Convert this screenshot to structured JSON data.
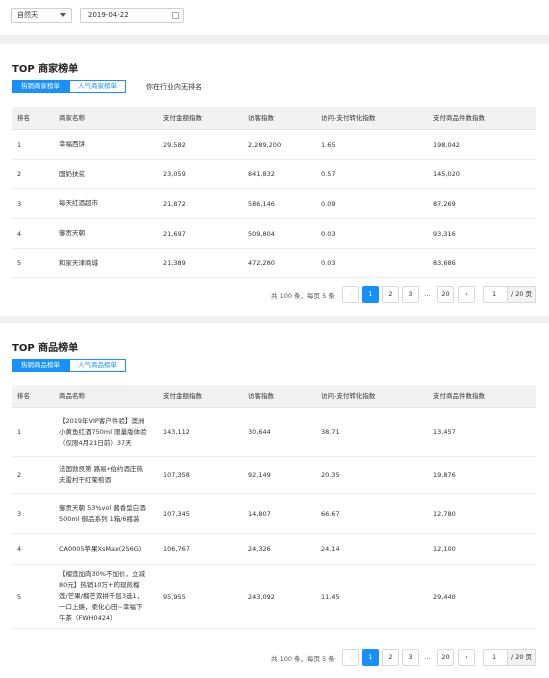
{
  "filters": {
    "period": "自然天",
    "date": "2019-04-22"
  },
  "merchant_section": {
    "title": "TOP 商家榜单",
    "tabs": [
      "热销商家榜单",
      "人气商家榜单"
    ],
    "note": "你在行业内无排名",
    "columns": [
      "排名",
      "商家名称",
      "支付金额指数",
      "访客指数",
      "访问-支付转化指数",
      "支付商品件数指数"
    ],
    "rows": [
      [
        "1",
        "幸福西饼",
        "29,582",
        "2,289,200",
        "1.65",
        "198,042"
      ],
      [
        "2",
        "国奶扶贫",
        "23,059",
        "841,832",
        "0.57",
        "145,020"
      ],
      [
        "3",
        "每天红酒超市",
        "21,872",
        "586,146",
        "0.09",
        "87,269"
      ],
      [
        "4",
        "御贡天朝",
        "21,697",
        "509,804",
        "0.03",
        "93,316"
      ],
      [
        "5",
        "和家天津商城",
        "21,389",
        "472,280",
        "0.03",
        "83,686"
      ]
    ],
    "pager": {
      "total": "共 100 条，每页 5 条",
      "prev": "‹",
      "pages": [
        "1",
        "2",
        "3"
      ],
      "ellipsis": "...",
      "last": "20",
      "next": "›",
      "jump": "1",
      "suffix": "/ 20 页"
    }
  },
  "product_section": {
    "title": "TOP 商品榜单",
    "tabs": [
      "热销商品榜单",
      "人气商品榜单"
    ],
    "columns": [
      "排名",
      "商品名称",
      "支付金额指数",
      "访客指数",
      "访问-支付转化指数",
      "支付商品件数指数"
    ],
    "rows": [
      [
        "1",
        "【2019年VIP客户件验】澳洲\n小黄鱼红酒750ml 限量版体验\n（仅限4月21日前）37天",
        "143,112",
        "30,644",
        "38.71",
        "13,457"
      ],
      [
        "2",
        "法国勃艮第 路易•伯约酒庄热\n夫雷村干红葡萄酒",
        "107,358",
        "92,149",
        "20.35",
        "19,876"
      ],
      [
        "3",
        "御贡天朝 53%vol 酱香型白酒\n500ml 御品系列 1箱/6瓶装",
        "107,345",
        "14,807",
        "66.67",
        "12,780"
      ],
      [
        "4",
        "CA0005苹果XsMax(256G)",
        "106,767",
        "24,326",
        "24.14",
        "12,100"
      ],
      [
        "5",
        "【榴莲加肉30%不加价，立减\n80元】热销10万+的现煎榴\n莲/芒果/榴芒双拼千层3选1，\n一口上瘾，柔化心田~幸福下\n午茶（FWH0424）",
        "95,955",
        "243,092",
        "11.45",
        "29,440"
      ]
    ],
    "pager": {
      "total": "共 100 条，每页 5 条",
      "prev": "‹",
      "pages": [
        "1",
        "2",
        "3"
      ],
      "ellipsis": "...",
      "last": "20",
      "next": "›",
      "jump": "1",
      "suffix": "/ 20 页"
    }
  },
  "colors": {
    "accent": "#1890ff",
    "page_bg": "#f0f0f0",
    "header_bg": "#f2f2f2"
  }
}
